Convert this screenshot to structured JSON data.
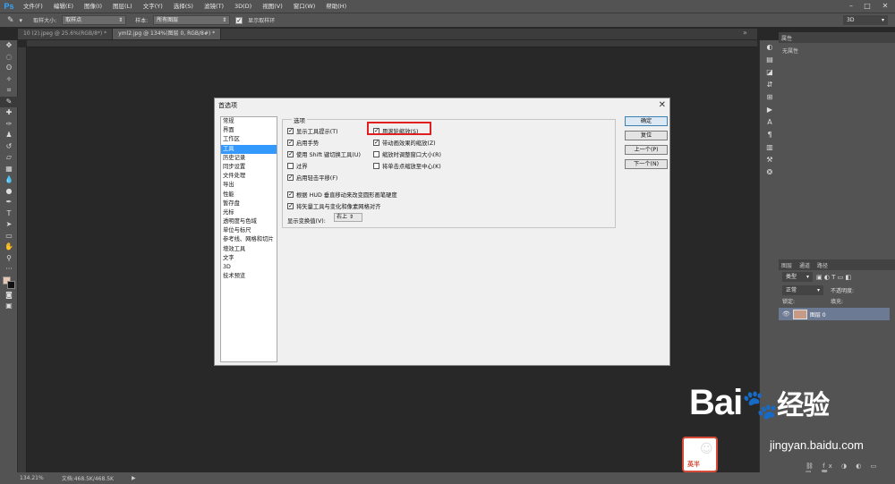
{
  "app": {
    "logo": "Ps",
    "menus": [
      "文件(F)",
      "编辑(E)",
      "图像(I)",
      "图层(L)",
      "文字(Y)",
      "选择(S)",
      "滤镜(T)",
      "3D(D)",
      "视图(V)",
      "窗口(W)",
      "帮助(H)"
    ]
  },
  "optbar": {
    "sample_size_label": "取样大小:",
    "sample_size_value": "取样点",
    "sample_label": "样本:",
    "sample_value": "所有图层",
    "ring_label": "显示取样环",
    "workspace": "3D"
  },
  "tabs": [
    {
      "label": "10 (2).jpeg @ 25.6%(RGB/8*) *"
    },
    {
      "label": "yml2.jpg @ 134%(图层 0, RGB/8#) *"
    }
  ],
  "status": {
    "zoom": "134.21%",
    "doc": "文档:468.5K/468.5K"
  },
  "panels": {
    "properties": "属性",
    "no_props": "无属性",
    "layers_tabs": [
      "图层",
      "通道",
      "路径"
    ],
    "filter": "类型",
    "blend": "正常",
    "opacity_label": "不透明度:",
    "lock_label": "锁定:",
    "fill_label": "填充:",
    "layer_name": "图层 0"
  },
  "dialog": {
    "title": "首选项",
    "close": "✕",
    "nav": [
      "常规",
      "界面",
      "工作区",
      "工具",
      "历史记录",
      "同步设置",
      "文件处理",
      "导出",
      "性能",
      "暂存盘",
      "光标",
      "透明度与色域",
      "单位与标尺",
      "参考线、网格和切片",
      "增效工具",
      "文字",
      "3D",
      "技术预览"
    ],
    "group_label": "选项",
    "options_left": [
      "显示工具提示(T)",
      "启用手势",
      "使用 Shift 键切换工具(U)",
      "过界",
      "启用轻击平移(F)"
    ],
    "options_right": [
      "用滚轮缩放(S)",
      "带动画效果的缩放(Z)",
      "缩放时调整窗口大小(R)",
      "将单击点缩放至中心(K)"
    ],
    "options_wide": [
      "根据 HUD 垂直移动来改变圆形画笔硬度",
      "将矢量工具与变化和像素网格对齐"
    ],
    "zoom_clicks_label": "显示变换值(V):",
    "zoom_clicks_value": "右上",
    "buttons": {
      "ok": "确定",
      "reset": "复位",
      "prev": "上一个(P)",
      "next": "下一个(N)"
    }
  },
  "watermark": {
    "brand": "Bai",
    "brand_suffix": "经验",
    "url": "jingyan.baidu.com",
    "avatar_text": "英半"
  }
}
